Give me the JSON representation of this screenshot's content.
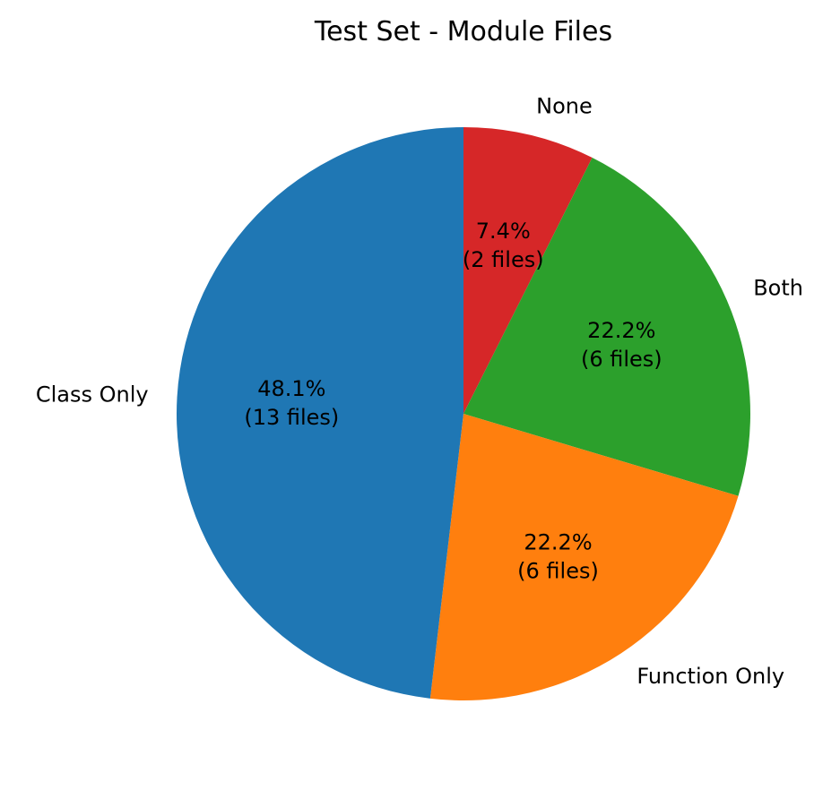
{
  "chart_data": {
    "type": "pie",
    "title": "Test Set - Module Files",
    "start_angle_deg": 90,
    "direction": "clockwise",
    "slices": [
      {
        "label": "None",
        "value": 2,
        "percent_text": "7.4%",
        "count_text": "(2 files)",
        "color": "#d62728"
      },
      {
        "label": "Both",
        "value": 6,
        "percent_text": "22.2%",
        "count_text": "(6 files)",
        "color": "#2ca02c"
      },
      {
        "label": "Function Only",
        "value": 6,
        "percent_text": "22.2%",
        "count_text": "(6 files)",
        "color": "#ff7f0e"
      },
      {
        "label": "Class Only",
        "value": 13,
        "percent_text": "48.1%",
        "count_text": "(13 files)",
        "color": "#1f77b4"
      }
    ]
  }
}
